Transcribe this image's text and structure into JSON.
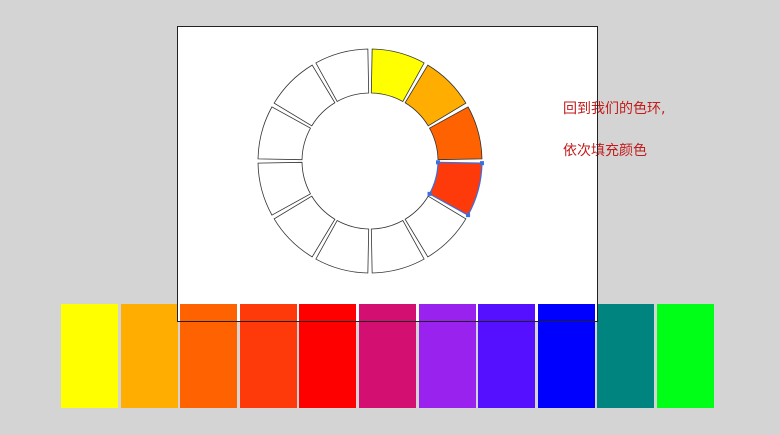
{
  "annotation": {
    "line1": "回到我们的色环,",
    "line2": "依次填充颜色"
  },
  "color_wheel": {
    "segments": [
      {
        "fill": "#ffff00",
        "selected": false
      },
      {
        "fill": "#ffad00",
        "selected": false
      },
      {
        "fill": "#ff6200",
        "selected": false
      },
      {
        "fill": "#ff3a0a",
        "selected": true
      },
      {
        "fill": "#ffffff",
        "selected": false
      },
      {
        "fill": "#ffffff",
        "selected": false
      },
      {
        "fill": "#ffffff",
        "selected": false
      },
      {
        "fill": "#ffffff",
        "selected": false
      },
      {
        "fill": "#ffffff",
        "selected": false
      },
      {
        "fill": "#ffffff",
        "selected": false
      },
      {
        "fill": "#ffffff",
        "selected": false
      },
      {
        "fill": "#ffffff",
        "selected": false
      }
    ],
    "selection_color": "#3a6fe0"
  },
  "palette": {
    "swatches": [
      "#ffff00",
      "#ffad00",
      "#ff6200",
      "#ff3a0a",
      "#ff0000",
      "#d30f72",
      "#9a22ee",
      "#5410ff",
      "#0000ff",
      "#008480",
      "#00ff17"
    ]
  }
}
